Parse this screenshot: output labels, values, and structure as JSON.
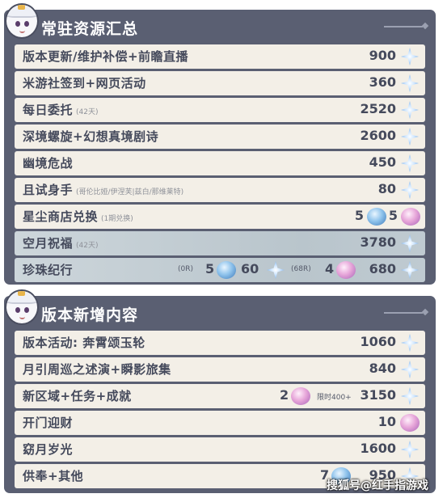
{
  "panels": {
    "standing": {
      "title": "常驻资源汇总",
      "rows": [
        {
          "label": "版本更新/维护补偿+前瞻直播",
          "amount": "900",
          "icon": "primogem-icon"
        },
        {
          "label": "米游社签到+网页活动",
          "amount": "360",
          "icon": "primogem-icon"
        },
        {
          "label": "每日委托",
          "note": "(42天)",
          "amount": "2520",
          "icon": "primogem-icon"
        },
        {
          "label": "深境螺旋+幻想真境剧诗",
          "amount": "2600",
          "icon": "primogem-icon"
        },
        {
          "label": "幽境危战",
          "amount": "450",
          "icon": "primogem-icon"
        },
        {
          "label": "且试身手",
          "note": "(哥伦比娅/伊涅芙|兹白/那维莱特)",
          "amount": "80",
          "icon": "primogem-icon"
        },
        {
          "label": "星尘商店兑换",
          "note": "(1期兑换)",
          "amount_blue": "5",
          "amount_pink": "5",
          "icon": "fate-icon"
        },
        {
          "label": "空月祝福",
          "note": "(42天)",
          "amount": "3780",
          "icon": "primogem-icon",
          "highlight": true
        },
        {
          "label": "珍珠纪行",
          "free_tag": "(0R)",
          "free_count": "5",
          "free_prim": "60",
          "paid_tag": "(68R)",
          "paid_count": "4",
          "paid_prim": "680",
          "highlight": true
        }
      ]
    },
    "new": {
      "title": "版本新增内容",
      "rows": [
        {
          "label": "版本活动: 奔霄颂玉轮",
          "amount": "1060",
          "icon": "primogem-icon"
        },
        {
          "label": "月引周巡之述演+瞬影旅集",
          "amount": "840",
          "icon": "primogem-icon"
        },
        {
          "label": "新区域+任务+成就",
          "fate_count": "2",
          "limit_text": "限时400+",
          "amount": "3150",
          "icon": "primogem-icon"
        },
        {
          "label": "开门迎财",
          "amount": "10",
          "icon": "pink-fate-icon"
        },
        {
          "label": "窈月岁光",
          "amount": "1600",
          "icon": "primogem-icon"
        },
        {
          "label": "供奉+其他",
          "fate_count": "7",
          "amount": "950",
          "icon": "primogem-icon"
        }
      ]
    }
  },
  "watermark": "搜狐号@红手指游戏",
  "colors": {
    "panel_bg": "#5a5f72",
    "row_bg": "#f3efe7",
    "row_highlight": "#c3cdd3",
    "text": "#454a5c"
  }
}
